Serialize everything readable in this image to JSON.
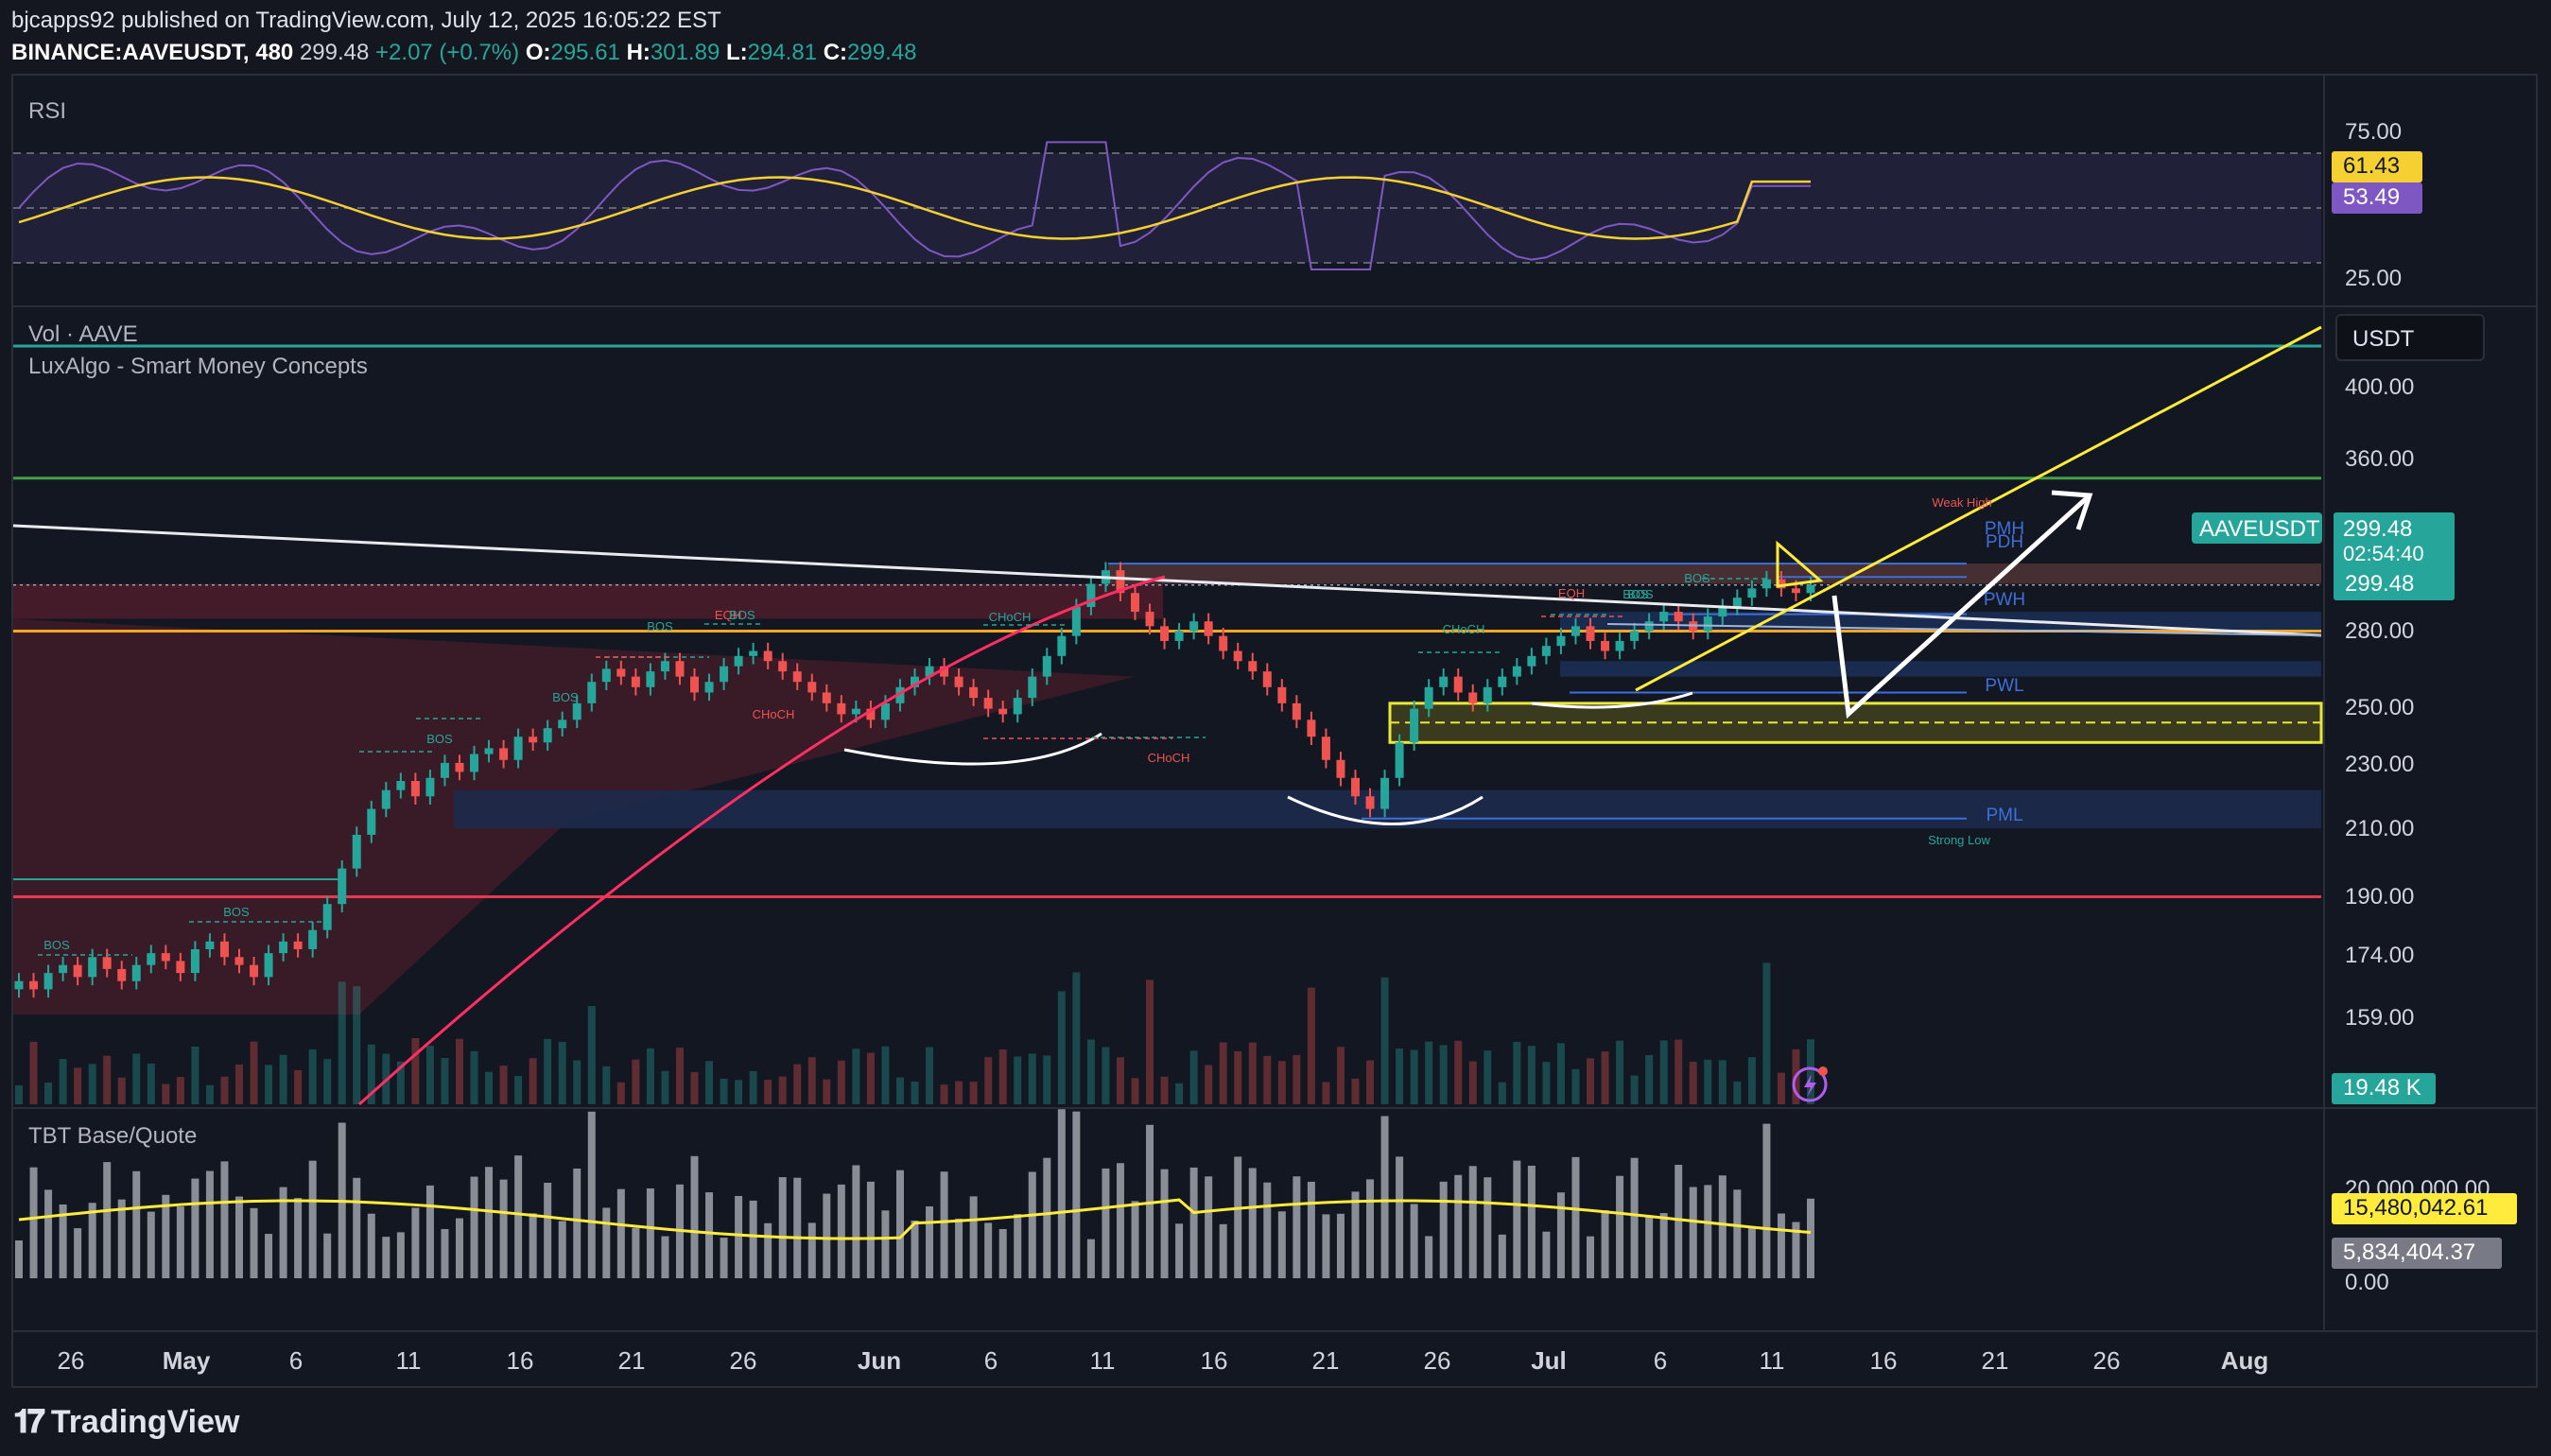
{
  "header": {
    "line1": "bjcapps92 published on TradingView.com, July 12, 2025 16:05:22 EST",
    "symbol": "BINANCE:AAVEUSDT, 480",
    "last": "299.48",
    "change": "+2.07 (+0.7%)",
    "open_label": "O:",
    "open": "295.61",
    "high_label": "H:",
    "high": "301.89",
    "low_label": "L:",
    "low": "294.81",
    "close_label": "C:",
    "close": "299.48"
  },
  "panes": {
    "rsi_label": "RSI",
    "vol_label": "Vol · AAVE",
    "smc_label": "LuxAlgo - Smart Money Concepts",
    "tbt_label": "TBT Base/Quote"
  },
  "currency_button": "USDT",
  "footer": {
    "logo_text": "TradingView"
  },
  "chart_data": {
    "type": "candlestick",
    "title": "BINANCE:AAVEUSDT, 480",
    "price_axis": {
      "scale": "log",
      "ticks": [
        "400.00",
        "360.00",
        "280.00",
        "250.00",
        "230.00",
        "210.00",
        "190.00",
        "174.00",
        "159.00"
      ]
    },
    "x_ticks": [
      "26",
      "May",
      "6",
      "11",
      "16",
      "21",
      "26",
      "Jun",
      "6",
      "11",
      "16",
      "21",
      "26",
      "Jul",
      "6",
      "11",
      "16",
      "21",
      "26",
      "Aug"
    ],
    "price_tags": {
      "symbol": "AAVEUSDT",
      "last": "299.48",
      "countdown": "02:54:40",
      "line_value": "299.48",
      "colors": {
        "up": "#26a69a",
        "down": "#ef5350"
      }
    },
    "close_series_approx": [
      168,
      166,
      170,
      172,
      169,
      174,
      171,
      168,
      172,
      175,
      173,
      170,
      176,
      178,
      174,
      172,
      169,
      175,
      178,
      176,
      181,
      188,
      198,
      208,
      216,
      222,
      225,
      220,
      226,
      231,
      228,
      234,
      236,
      232,
      240,
      238,
      243,
      246,
      252,
      260,
      265,
      262,
      258,
      264,
      268,
      262,
      256,
      260,
      266,
      270,
      272,
      268,
      264,
      260,
      256,
      252,
      248,
      250,
      246,
      252,
      258,
      262,
      266,
      262,
      258,
      254,
      250,
      248,
      254,
      262,
      270,
      278,
      290,
      300,
      306,
      296,
      288,
      282,
      276,
      280,
      284,
      278,
      272,
      268,
      264,
      258,
      252,
      246,
      240,
      232,
      226,
      220,
      216,
      226,
      238,
      250,
      258,
      262,
      256,
      252,
      258,
      262,
      266,
      270,
      274,
      278,
      282,
      276,
      272,
      276,
      280,
      284,
      288,
      284,
      280,
      286,
      290,
      294,
      298,
      302,
      298,
      296,
      299.48
    ],
    "smc": {
      "labels": [
        "BOS",
        "BOS",
        "BOS",
        "BOS",
        "BOS",
        "BOS",
        "EQH",
        "BOS",
        "CHoCH",
        "CHoCH",
        "CHoCH",
        "CHoCH",
        "EQH",
        "BOS",
        "BOS",
        "PMH",
        "PDH",
        "PWH",
        "PWL",
        "PML",
        "Weak High",
        "Strong Low"
      ],
      "levels": {
        "PMH": 309,
        "PDH": 303,
        "PWH": 287,
        "PWL": 256,
        "PML": 213
      }
    },
    "rsi": {
      "ticks": [
        "75.00",
        "25.00"
      ],
      "rsi_value": "61.43",
      "rsi_ma_value": "53.49",
      "colors": {
        "rsi": "#7e57c2",
        "ma": "#f5d033",
        "band": "#2b2a4a"
      }
    },
    "volume": {
      "value": "19.48 K"
    },
    "tbt": {
      "ticks": [
        "20,000,000.00",
        "0.00"
      ],
      "value_yellow": "15,480,042.61",
      "value_gray": "5,834,404.37"
    },
    "levels_horizontal": {
      "green_upper": 420,
      "green": 350,
      "orange": 280,
      "red": 190
    },
    "grid": false
  }
}
